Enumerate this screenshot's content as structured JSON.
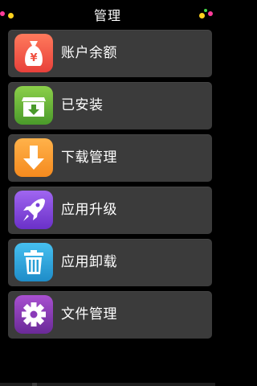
{
  "header": {
    "title": "管理"
  },
  "menu": {
    "items": [
      {
        "label": "账户余额",
        "icon": "money-bag-icon",
        "color": "#f45a4a"
      },
      {
        "label": "已安装",
        "icon": "install-box-icon",
        "color": "#5aa837"
      },
      {
        "label": "下载管理",
        "icon": "download-arrow-icon",
        "color": "#f89a2a"
      },
      {
        "label": "应用升级",
        "icon": "rocket-icon",
        "color": "#8a4ae0"
      },
      {
        "label": "应用卸载",
        "icon": "trash-icon",
        "color": "#2a9fd6"
      },
      {
        "label": "文件管理",
        "icon": "gear-icon",
        "color": "#8a3ab8"
      }
    ]
  },
  "colors": {
    "background": "#000000",
    "item_background": "#3b3b3b",
    "text": "#ffffff"
  }
}
